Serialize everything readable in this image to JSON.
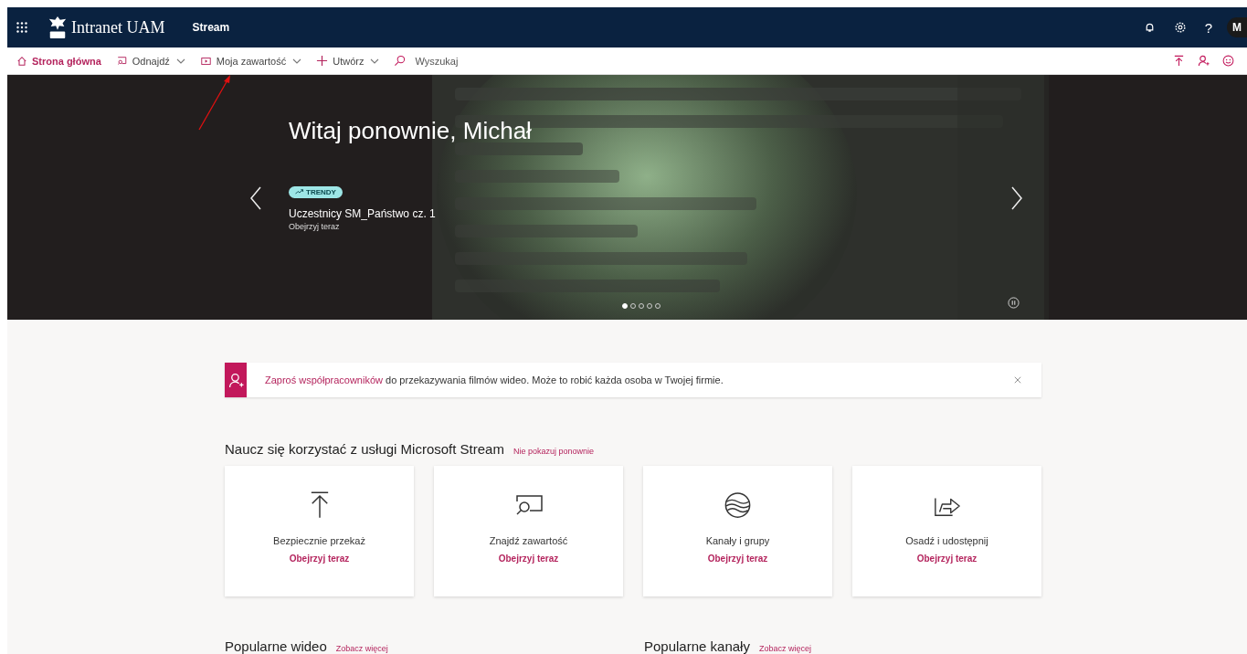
{
  "app_bar": {
    "org": "Intranet UAM",
    "app": "Stream",
    "help": "?",
    "avatar": "M"
  },
  "nav": [
    {
      "label": "Strona główna",
      "selected": true,
      "dropdown": false
    },
    {
      "label": "Odnajdź",
      "selected": false,
      "dropdown": true
    },
    {
      "label": "Moja zawartość",
      "selected": false,
      "dropdown": true
    },
    {
      "label": "Utwórz",
      "selected": false,
      "dropdown": true
    }
  ],
  "search": {
    "placeholder": "Wyszukaj"
  },
  "hero": {
    "greeting": "Witaj ponownie, Michał",
    "badge": "TRENDY",
    "title": "Uczestnicy SM_Państwo cz. 1",
    "subtitle": "Obejrzyj teraz",
    "slides": [
      {
        "selected": true
      },
      {
        "selected": false
      },
      {
        "selected": false
      },
      {
        "selected": false
      },
      {
        "selected": false
      }
    ]
  },
  "banner": {
    "link": "Zaproś współpracowników",
    "text": " do przekazywania filmów wideo. Może to robić każda osoba w Twojej firmie."
  },
  "learn": {
    "title": "Naucz się korzystać z usługi Microsoft Stream",
    "dismiss": "Nie pokazuj ponownie",
    "cards": [
      {
        "label": "Bezpiecznie przekaż",
        "action": "Obejrzyj teraz"
      },
      {
        "label": "Znajdź zawartość",
        "action": "Obejrzyj teraz"
      },
      {
        "label": "Kanały i grupy",
        "action": "Obejrzyj teraz"
      },
      {
        "label": "Osadź i udostępnij",
        "action": "Obejrzyj teraz"
      }
    ]
  },
  "popular": [
    {
      "title": "Popularne wideo",
      "more": "Zobacz więcej"
    },
    {
      "title": "Popularne kanały",
      "more": "Zobacz więcej"
    }
  ]
}
